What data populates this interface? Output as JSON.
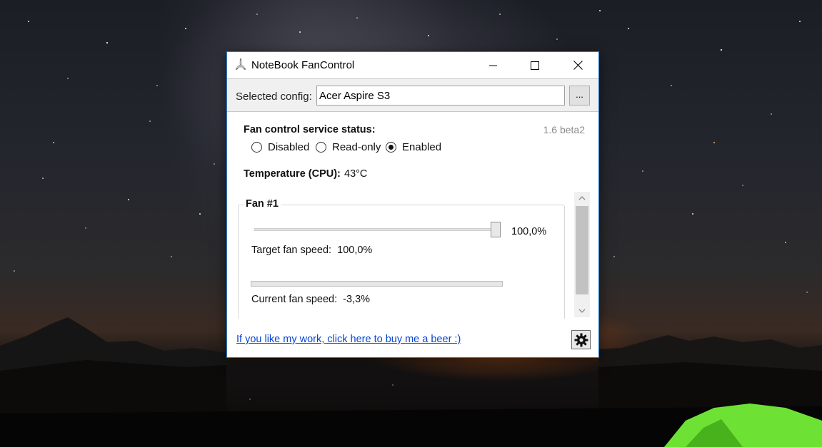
{
  "window": {
    "title": "NoteBook FanControl",
    "accent_color": "#2d7fd0",
    "title_icon": "fan-icon",
    "controls": [
      "minimize-icon",
      "maximize-icon",
      "close-icon"
    ]
  },
  "config": {
    "label": "Selected config:",
    "value": "Acer Aspire S3",
    "browse_label": "..."
  },
  "status": {
    "heading": "Fan control service status:",
    "version": "1.6 beta2",
    "options": [
      {
        "label": "Disabled",
        "selected": false
      },
      {
        "label": "Read-only",
        "selected": false
      },
      {
        "label": "Enabled",
        "selected": true
      }
    ]
  },
  "temperature": {
    "label": "Temperature (CPU):",
    "value": "43°C"
  },
  "fan": {
    "title": "Fan #1",
    "slider_percent": 100,
    "slider_value": "100,0%",
    "target_label": "Target fan speed:",
    "target_value": "100,0%",
    "current_label": "Current fan speed:",
    "current_value": "-3,3%",
    "current_percent": 0
  },
  "footer": {
    "link": "If you like my work, click here to buy me a beer :)",
    "settings_icon": "gear-icon",
    "link_color": "#0645d6"
  }
}
